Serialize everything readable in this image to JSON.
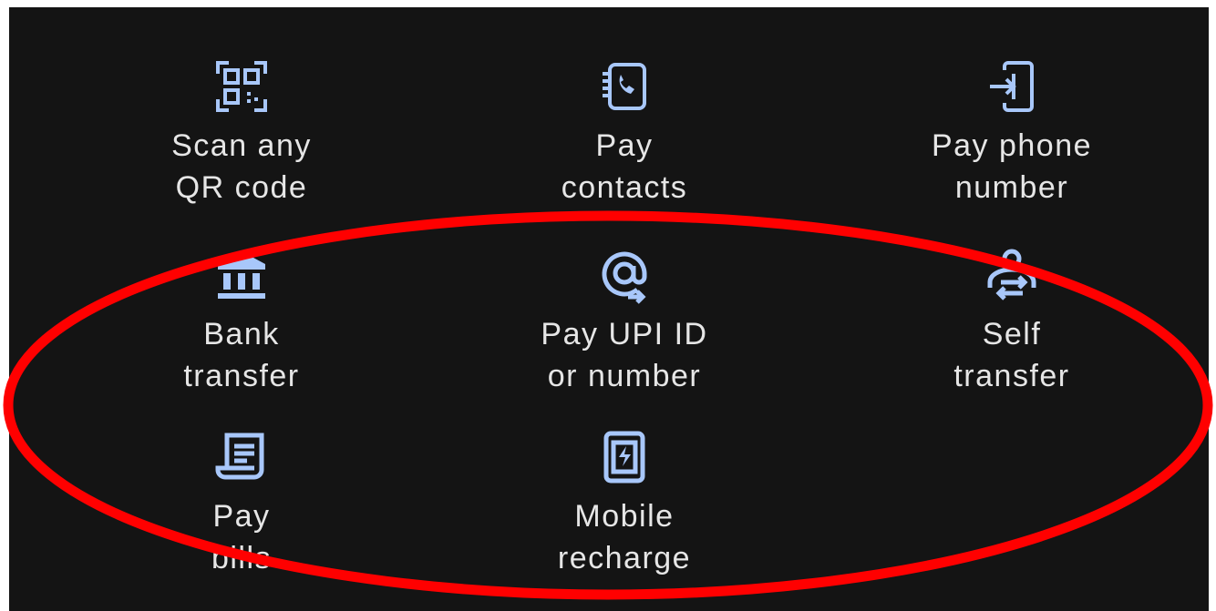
{
  "actions": [
    {
      "key": "scan",
      "icon": "qr-scan-icon",
      "line1": "Scan any",
      "line2": "QR code"
    },
    {
      "key": "contacts",
      "icon": "contacts-phone-icon",
      "line1": "Pay",
      "line2": "contacts"
    },
    {
      "key": "phone",
      "icon": "phone-enter-icon",
      "line1": "Pay phone",
      "line2": "number"
    },
    {
      "key": "bank",
      "icon": "bank-icon",
      "line1": "Bank",
      "line2": "transfer"
    },
    {
      "key": "upi",
      "icon": "at-sign-arrow-icon",
      "line1": "Pay UPI ID",
      "line2": "or number"
    },
    {
      "key": "self",
      "icon": "self-transfer-icon",
      "line1": "Self",
      "line2": "transfer"
    },
    {
      "key": "bills",
      "icon": "bill-receipt-icon",
      "line1": "Pay",
      "line2": "bills"
    },
    {
      "key": "recharge",
      "icon": "mobile-recharge-icon",
      "line1": "Mobile",
      "line2": "recharge"
    }
  ],
  "colors": {
    "background": "#141414",
    "icon": "#a8c7fa",
    "label": "#e6e6e6",
    "annotation": "#ff0000"
  }
}
